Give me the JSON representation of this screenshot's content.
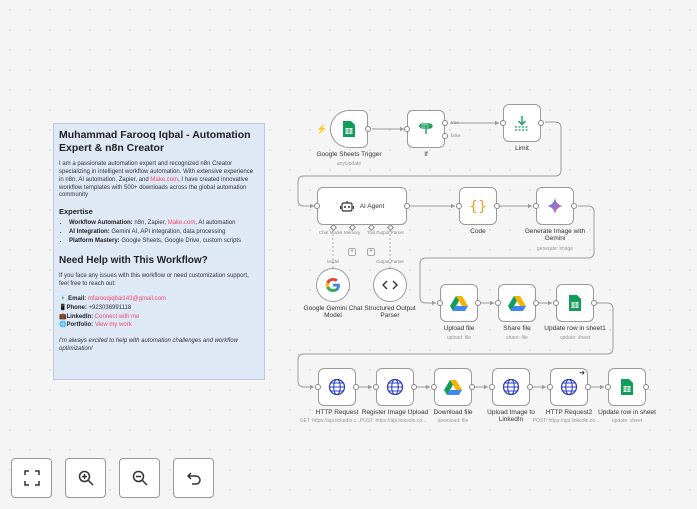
{
  "note": {
    "title": "Muhammad Farooq Iqbal - Automation Expert & n8n Creator",
    "intro_1": "I am a passionate automation expert and recognized n8n Creator specializing in intelligent workflow automation. With extensive experience in n8n, AI automation, Zapier, and ",
    "intro_link": "Make.com",
    "intro_2": ", I have created innovative workflow templates with 500+ downloads across the global automation community",
    "expertise_heading": "Expertise",
    "expertise": [
      {
        "label": "Workflow Automation:",
        "text_1": " n8n, Zapier, ",
        "link": "Make.com",
        "text_2": ", AI automation"
      },
      {
        "label": "AI Integration:",
        "text_1": " Gemini AI, API integration, data processing",
        "link": "",
        "text_2": ""
      },
      {
        "label": "Platform Mastery:",
        "text_1": " Google Sheets, Google Drive, custom scripts",
        "link": "",
        "text_2": ""
      }
    ],
    "help_heading": "Need Help with This Workflow?",
    "help_text": "If you face any issues with this workflow or need customization support, feel free to reach out:",
    "contact": [
      {
        "icon": "📧",
        "label": "Email:",
        "value": "mfarooqiqbal143@gmail.com",
        "is_link": true
      },
      {
        "icon": "📱",
        "label": "Phone:",
        "value": "+923036991118",
        "is_link": false
      },
      {
        "icon": "💼",
        "label": "LinkedIn:",
        "value": "Connect with me",
        "is_link": true
      },
      {
        "icon": "🌐",
        "label": "Portfolio:",
        "value": "View my work",
        "is_link": true
      }
    ],
    "closing": "I'm always excited to help with automation challenges and workflow optimization!"
  },
  "nodes": {
    "sheets_trigger": {
      "label": "Google Sheets Trigger",
      "sub": "anyUpdate",
      "icon": "google-sheets-icon"
    },
    "if": {
      "label": "If",
      "true_label": "true",
      "false_label": "false",
      "icon": "if-icon"
    },
    "limit": {
      "label": "Limit",
      "icon": "limit-icon"
    },
    "ai_agent": {
      "label": "AI Agent",
      "icon": "robot-icon",
      "ports": [
        "Chat Model",
        "Memory",
        "Tool",
        "Output Parser"
      ]
    },
    "code": {
      "label": "Code",
      "icon": "code-braces-icon"
    },
    "gen_image": {
      "label": "Generate Image with Gemini",
      "sub": "generate: image",
      "icon": "gemini-icon"
    },
    "gemini_model": {
      "label": "Google Gemini Chat Model",
      "sub_port": "Model",
      "icon": "google-g-icon"
    },
    "output_parser": {
      "label": "Structured Output Parser",
      "sub_port": "Output Parser",
      "icon": "code-tags-icon"
    },
    "upload_file": {
      "label": "Upload file",
      "sub": "upload: file",
      "icon": "google-drive-icon"
    },
    "share_file": {
      "label": "Share file",
      "sub": "share: file",
      "icon": "google-drive-icon"
    },
    "update_row_1": {
      "label": "Update row in sheet1",
      "sub": "update: sheet",
      "icon": "google-sheets-icon"
    },
    "http_request": {
      "label": "HTTP Request",
      "sub": "GET: https://api.linkedin.c...",
      "icon": "globe-icon"
    },
    "register_image": {
      "label": "Register Image Upload",
      "sub": "POST: https://api.linkedin.co...",
      "icon": "globe-icon"
    },
    "download_file": {
      "label": "Download file",
      "sub": "download: file",
      "icon": "google-drive-icon"
    },
    "upload_linkedin": {
      "label": "Upload Image to LinkedIn",
      "sub": "",
      "icon": "globe-icon"
    },
    "http_request2": {
      "label": "HTTP Request2",
      "sub": "POST: https://api.linkedin.co...",
      "icon": "globe-icon"
    },
    "update_row_2": {
      "label": "Update row in sheet",
      "sub": "update: sheet",
      "icon": "google-sheets-icon"
    }
  },
  "controls": [
    {
      "name": "fit-view-button",
      "icon": "fit-view-icon"
    },
    {
      "name": "zoom-in-button",
      "icon": "zoom-in-icon"
    },
    {
      "name": "zoom-out-button",
      "icon": "zoom-out-icon"
    },
    {
      "name": "undo-button",
      "icon": "undo-icon"
    }
  ],
  "colors": {
    "sheets_green": "#0f9d58",
    "drive_yellow": "#f4b400",
    "drive_blue": "#4285f4",
    "accent_pink": "#ea4b71",
    "globe_blue": "#2f3fc0",
    "code_orange": "#f39c12",
    "limit_teal": "#1b9e5b"
  }
}
